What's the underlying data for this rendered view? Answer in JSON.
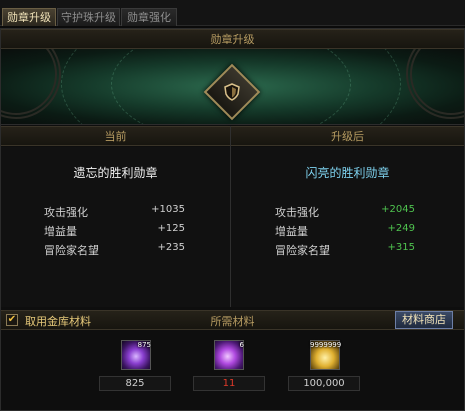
{
  "tabs": [
    {
      "label": "勋章升级",
      "active": true
    },
    {
      "label": "守护珠升级",
      "active": false
    },
    {
      "label": "勋章强化",
      "active": false
    }
  ],
  "section_title": "勋章升级",
  "current": {
    "header": "当前",
    "medal_name": "遗忘的胜利勋章",
    "stats": [
      {
        "label": "攻击强化",
        "value": "+1035"
      },
      {
        "label": "增益量",
        "value": "+125"
      },
      {
        "label": "冒险家名望",
        "value": "+235"
      }
    ]
  },
  "after": {
    "header": "升级后",
    "medal_name": "闪亮的胜利勋章",
    "stats": [
      {
        "label": "攻击强化",
        "value": "+2045"
      },
      {
        "label": "增益量",
        "value": "+249"
      },
      {
        "label": "冒险家名望",
        "value": "+315"
      }
    ]
  },
  "materials": {
    "use_storage_label": "取用金库材料",
    "use_storage_checked": true,
    "title": "所需材料",
    "shop_button": "材料商店",
    "items": [
      {
        "icon": "purple-orb-icon",
        "count_badge": "875",
        "required": "825",
        "required_color": "#cfcfcf"
      },
      {
        "icon": "violet-crystal-icon",
        "count_badge": "6",
        "required": "11",
        "required_color": "#e03a2a"
      },
      {
        "icon": "gold-coins-icon",
        "count_badge": "9999999",
        "required": "100,000",
        "required_color": "#cfcfcf"
      }
    ]
  },
  "colors": {
    "accent_gold": "#b79c62",
    "current_name": "#f2f2f2",
    "after_name": "#7fd3f0",
    "after_value": "#4fc34f",
    "current_value": "#d0d0d0",
    "insufficient": "#e03a2a"
  }
}
